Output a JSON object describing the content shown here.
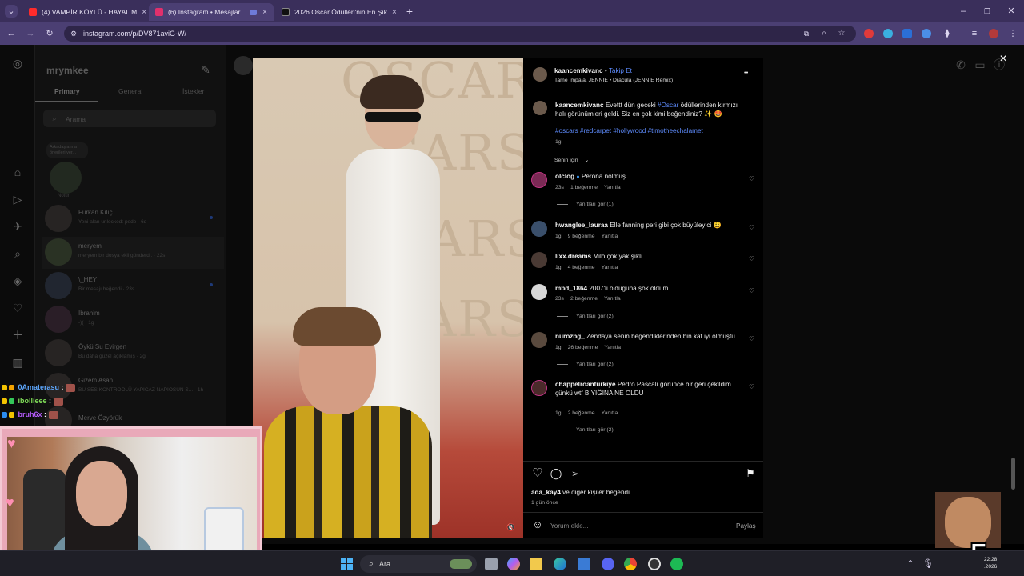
{
  "browser": {
    "tabs": [
      {
        "title": "(4) VAMPİR KÖYLÜ - HAYAL M",
        "icon": "youtube-icon",
        "color": "#ff2b2b"
      },
      {
        "title": "(6) Instagram • Mesajlar",
        "icon": "instagram-icon",
        "color": "#e1306c"
      },
      {
        "title": "2026 Oscar Ödülleri'nin En Şık",
        "icon": "page-icon",
        "color": "#111111"
      }
    ],
    "close_glyph": "×",
    "new_tab_glyph": "+",
    "url": "instagram.com/p/DV871aviG-W/"
  },
  "instagram": {
    "username": "mrymkee",
    "tabs": [
      "Primary",
      "General",
      "İstekler"
    ],
    "search_placeholder": "Arama",
    "note": {
      "line1": "Arkadaşlarına",
      "line2": "önerileri ver...",
      "label": "Notun"
    },
    "conversations": [
      {
        "name": "Furkan Kılıç",
        "preview": "Yeni alan unlocked: pede · 6d",
        "unread": true
      },
      {
        "name": "meryem",
        "preview": "meryem bir dosya ekli gönderdi. · 22s",
        "unread": false
      },
      {
        "name": "\\_HEY",
        "preview": "Bir mesajı beğendi · 23s",
        "unread": true
      },
      {
        "name": "İbrahim",
        "preview": "-)( · 1g",
        "unread": false
      },
      {
        "name": "Öykü Su Evirgen",
        "preview": "Bu daha güzel açıklamış · 2g",
        "unread": false
      },
      {
        "name": "Gizem Asan",
        "preview": "BU SES KONTROOLÜ YAPICAZ NAPIOSUN S... · 1h",
        "unread": false
      },
      {
        "name": "Merve Özyörük",
        "preview": "",
        "unread": false
      }
    ]
  },
  "post": {
    "author": "kaancemkivanc",
    "follow": "Takip Et",
    "audio": "Tame Impala, JENNIE • Dracula (JENNIE Remix)",
    "more": "•••",
    "caption_user": "kaancemkivanc",
    "caption_pre": "Evettt dün geceki",
    "caption_tag": "#Oscar",
    "caption_post": "ödüllerinden kırmızı halı görünümleri geldi. Siz en çok kimi beğendiniz? ✨ 🤩",
    "hashtags": "#oscars #redcarpet #hollywood #timotheechalamet",
    "caption_time": "1g",
    "sort_label": "Senin için",
    "comments": [
      {
        "user": "olclog",
        "verified": true,
        "text": "Perona nolmuş",
        "time": "23s",
        "likes": "1 beğenme",
        "reply": "Yanıtla",
        "view_replies": "Yanıtları gör (1)"
      },
      {
        "user": "hwanglee_lauraa",
        "verified": false,
        "text": "Elle fanning peri gibi çok büyüleyici 😩",
        "time": "1g",
        "likes": "9 beğenme",
        "reply": "Yanıtla",
        "view_replies": ""
      },
      {
        "user": "lixx.dreams",
        "verified": false,
        "text": "Milo çok yakışıklı",
        "time": "1g",
        "likes": "4 beğenme",
        "reply": "Yanıtla",
        "view_replies": ""
      },
      {
        "user": "mbd_1864",
        "verified": false,
        "text": "2007'li olduğuna şok oldum",
        "time": "23s",
        "likes": "2 beğenme",
        "reply": "Yanıtla",
        "view_replies": "Yanıtları gör (2)"
      },
      {
        "user": "nurozbg_",
        "verified": false,
        "text": "Zendaya senin beğendiklerinden bin kat iyi olmuştu",
        "time": "1g",
        "likes": "26 beğenme",
        "reply": "Yanıtla",
        "view_replies": "Yanıtları gör (2)"
      },
      {
        "user": "chappelroanturkiye",
        "verified": false,
        "text": "Pedro Pascalı görünce bir geri çekildim çünkü wtf BIYIĞINA NE OLDU",
        "time": "1g",
        "likes": "2 beğenme",
        "reply": "Yanıtla",
        "view_replies": "Yanıtları gör (2)"
      }
    ],
    "liked_by_user": "ada_kay4",
    "liked_by_rest": "ve diğer kişiler beğendi",
    "date": "1 gün önce",
    "comment_placeholder": "Yorum ekle...",
    "share": "Paylaş",
    "close": "×"
  },
  "media": {
    "oscar_text": "OSCARS",
    "oscar_partial_1": "ARS",
    "oscar_partial_2": "CARS"
  },
  "stream": {
    "chat": [
      {
        "name": "0Amaterasu",
        "color": "#5ea8ff"
      },
      {
        "name": "ibollieee",
        "color": "#7ed957"
      },
      {
        "name": "bruh6x",
        "color": "#b85cff"
      }
    ],
    "meme_text": "x5"
  },
  "taskbar": {
    "search": "Ara",
    "time": "22:28",
    "date": ".2026"
  }
}
